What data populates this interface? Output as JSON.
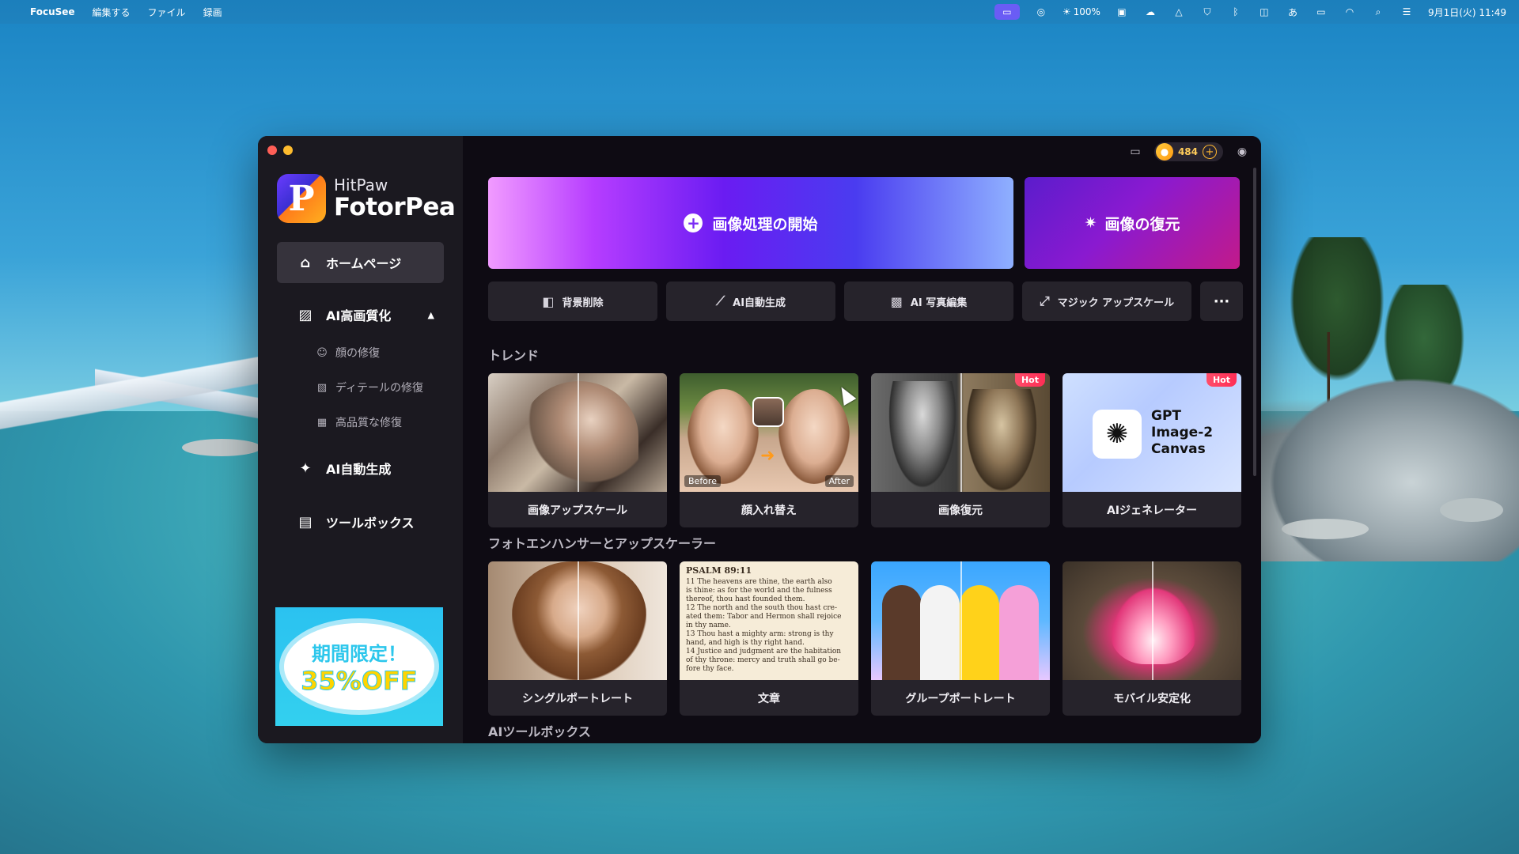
{
  "menubar": {
    "app_name": "FocuSee",
    "menus": [
      "編集する",
      "ファイル",
      "録画"
    ],
    "battery": "100%",
    "datetime": "9月1日(火) 11:49"
  },
  "app": {
    "logo_line1": "HitPaw",
    "logo_line2": "FotorPea",
    "credits": "484"
  },
  "sidebar": {
    "home": "ホームページ",
    "ai_enhance": "AI高画質化",
    "sub_items": [
      "顔の修復",
      "ディテールの修復",
      "高品質な修復"
    ],
    "ai_generate": "AI自動生成",
    "toolbox": "ツールボックス",
    "promo_line1": "期間限定！",
    "promo_line2": "35%OFF"
  },
  "hero": {
    "start_label": "画像処理の開始",
    "restore_label": "画像の復元"
  },
  "tools": [
    "背景削除",
    "AI自動生成",
    "AI 写真編集",
    "マジック アップスケール"
  ],
  "sections": {
    "trend": "トレンド",
    "enhancer": "フォトエンハンサーとアップスケーラー",
    "ai_toolbox": "AIツールボックス"
  },
  "trend_cards": [
    {
      "label": "画像アップスケール"
    },
    {
      "label": "顔入れ替え",
      "before": "Before",
      "after": "After"
    },
    {
      "label": "画像復元",
      "badge": "Hot"
    },
    {
      "label": "AIジェネレーター",
      "badge": "Hot",
      "gpt_line1": "GPT",
      "gpt_line2": "Image-2",
      "gpt_line3": "Canvas"
    }
  ],
  "enhancer_cards": [
    {
      "label": "シングルポートレート"
    },
    {
      "label": "文章",
      "doc_head": "PSALM 89:11",
      "doc_lines": [
        "11 The heavens are thine, the earth also",
        "is thine: as for the world and the fulness",
        "thereof, thou hast founded them.",
        "12 The north and the south thou hast cre-",
        "ated them: Tabor and Hermon shall rejoice",
        "in thy name.",
        "13 Thou hast a mighty arm: strong is thy",
        "hand, and high is thy right hand.",
        "14 Justice and judgment are the habitation",
        "of thy throne: mercy and truth shall go be-",
        "fore thy face."
      ]
    },
    {
      "label": "グループポートレート"
    },
    {
      "label": "モバイル安定化"
    }
  ]
}
